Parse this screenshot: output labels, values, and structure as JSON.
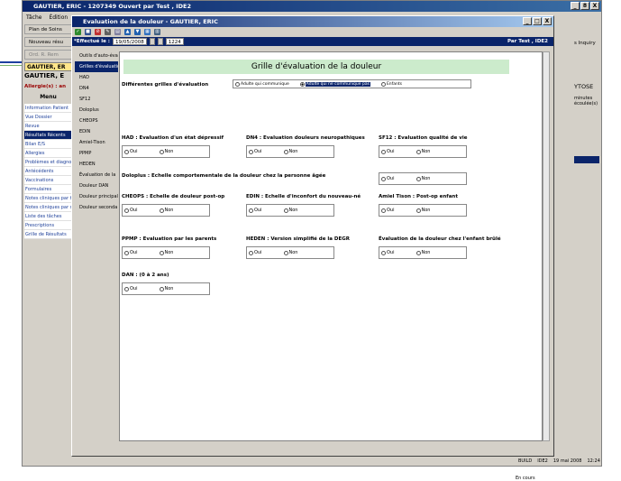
{
  "outer": {
    "title": "GAUTIER, ERIC - 1207349 Ouvert par Test , IDE2",
    "menu": [
      "Tâche",
      "Édition"
    ],
    "toolbar_label": "Plan de Soins",
    "bar2_label": "Nouveau résu",
    "bar3_label": "Ord. R. Rem",
    "patient_title": "GAUTIER, ER",
    "patient_name": "GAUTIER, E",
    "allergy": "Allergie(s) : an",
    "menu_header": "Menu",
    "menu_items": [
      "Information Patient",
      "Vue Dossier",
      "Revue",
      "Résultats Récents",
      "Bilan E/S",
      "Allergies",
      "Problèmes et diagnostics",
      "Antécédents",
      "Vaccinations",
      "Formulaires",
      "Notes cliniques par type",
      "Notes cliniques par date",
      "Liste des tâches",
      "Prescriptions",
      "Grille de Résultats"
    ],
    "menu_selected": 3,
    "right_text1": "s Inquiry",
    "right_text2": "YTOSE",
    "right_text3": "minutes écoulée(s)",
    "status": [
      "BUILD",
      "IDE2",
      "19 mai 2008",
      "12:24"
    ],
    "title_buttons": [
      "_",
      "8",
      "X"
    ]
  },
  "modal": {
    "title": "Evaluation de la douleur - GAUTIER, ERIC",
    "title_buttons": [
      "_",
      "□",
      "X"
    ],
    "effectue_label": "*Effectué le :",
    "date": "19/05/2008",
    "time": "1224",
    "user": "Par Test , IDE2",
    "nav": [
      "Outils d'auto-éva",
      "Grilles d'évaluatio",
      "HAD",
      "DN4",
      "SF12",
      "Doloplus",
      "CHEOPS",
      "EDIN",
      "Amiel-Tison",
      "PPMP",
      "HEDEN",
      "Évaluation de la",
      "Douleur DAN",
      "Douleur principal",
      "Douleur seconda"
    ],
    "nav_selected": 1,
    "header": "Grille d'évaluation de la douleur",
    "type_label": "Différentes grilles d'évaluation",
    "type_options": [
      "Adulte qui communique",
      "Adulte qui ne communique pas",
      "Enfants"
    ],
    "type_selected": 1,
    "oui": "Oui",
    "non": "Non",
    "scales": [
      {
        "label": "HAD : Evaluation d'un état dépressif"
      },
      {
        "label": "DN4 : Evaluation douleurs neuropathiques"
      },
      {
        "label": "SF12 : Evaluation qualité de vie"
      },
      {
        "label": "Doloplus : Echelle comportementale de la douleur chez la personne âgée"
      },
      {
        "label": "CHEOPS : Echelle de douleur post-op"
      },
      {
        "label": "EDIN : Echelle d'inconfort du nouveau-né"
      },
      {
        "label": "Amiel Tison : Post-op enfant"
      },
      {
        "label": "PPMP : Evaluation par les parents"
      },
      {
        "label": "HEDEN : Version simplifié de la DEGR"
      },
      {
        "label": "Évaluation de la douleur chez l'enfant brûlé"
      },
      {
        "label": "DAN : (0 à 2 ans)"
      }
    ],
    "en_cours": "En cours"
  }
}
